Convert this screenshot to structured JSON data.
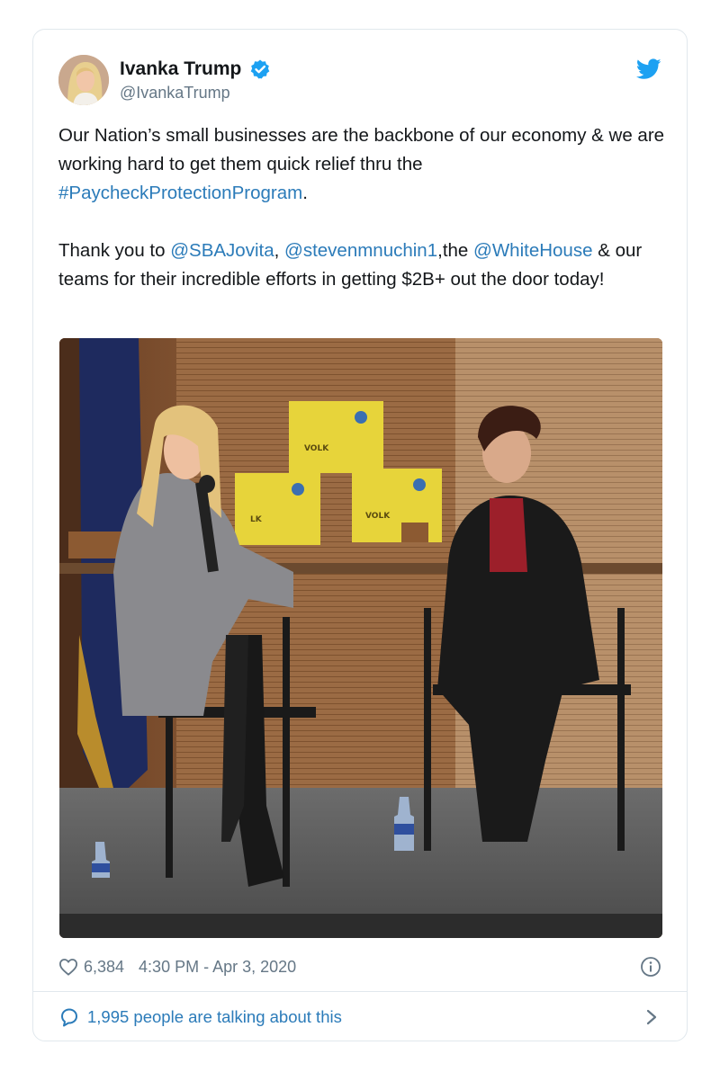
{
  "tweet": {
    "author": {
      "display_name": "Ivanka Trump",
      "handle": "@IvankaTrump",
      "verified": true
    },
    "text": {
      "p1_a": "Our Nation’s small businesses are the backbone of our economy & we are working hard to get them quick relief thru the ",
      "p1_hashtag": "#PaycheckProtectionProgram",
      "p1_end": ".",
      "p2_a": "Thank you to ",
      "p2_m1": "@SBAJovita",
      "p2_b": ", ",
      "p2_m2": "@stevenmnuchin1",
      "p2_c": ",the ",
      "p2_m3": "@WhiteHouse",
      "p2_d": " & our teams for their incredible efforts in getting $2B+ out the door today!"
    },
    "photo": {
      "box_label_1": "VOLK",
      "box_label_2": "VOLK",
      "box_label_3": "LK"
    },
    "likes": "6,384",
    "timestamp": "4:30 PM - Apr 3, 2020",
    "talking": "1,995 people are talking about this"
  },
  "colors": {
    "link": "#2b7bb9",
    "verified": "#1da1f2",
    "muted": "#657786"
  },
  "icons": [
    "twitter-bird-icon",
    "verified-badge-icon",
    "heart-icon",
    "info-icon",
    "speech-bubble-icon",
    "chevron-right-icon"
  ]
}
